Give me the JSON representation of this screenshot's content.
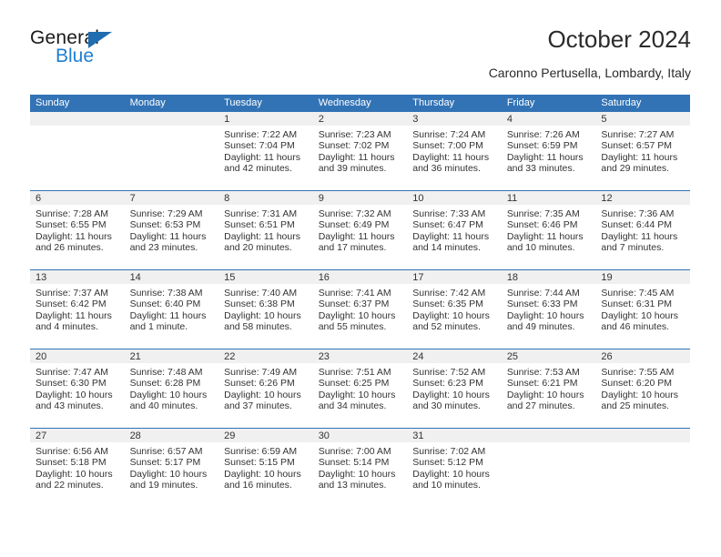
{
  "logo": {
    "word_top": "General",
    "word_bottom": "Blue",
    "triangle_color": "#1f6cb0",
    "blue_color": "#1f7fd1"
  },
  "header": {
    "title": "October 2024",
    "subtitle": "Caronno Pertusella, Lombardy, Italy"
  },
  "theme": {
    "header_blue": "#3273b5",
    "band_gray": "#f0f0f0",
    "text": "#333333"
  },
  "calendar": {
    "weekday_headers": [
      "Sunday",
      "Monday",
      "Tuesday",
      "Wednesday",
      "Thursday",
      "Friday",
      "Saturday"
    ],
    "weeks": [
      [
        {
          "day": "",
          "sunrise": "",
          "sunset": "",
          "daylight": ""
        },
        {
          "day": "",
          "sunrise": "",
          "sunset": "",
          "daylight": ""
        },
        {
          "day": "1",
          "sunrise": "Sunrise: 7:22 AM",
          "sunset": "Sunset: 7:04 PM",
          "daylight": "Daylight: 11 hours and 42 minutes."
        },
        {
          "day": "2",
          "sunrise": "Sunrise: 7:23 AM",
          "sunset": "Sunset: 7:02 PM",
          "daylight": "Daylight: 11 hours and 39 minutes."
        },
        {
          "day": "3",
          "sunrise": "Sunrise: 7:24 AM",
          "sunset": "Sunset: 7:00 PM",
          "daylight": "Daylight: 11 hours and 36 minutes."
        },
        {
          "day": "4",
          "sunrise": "Sunrise: 7:26 AM",
          "sunset": "Sunset: 6:59 PM",
          "daylight": "Daylight: 11 hours and 33 minutes."
        },
        {
          "day": "5",
          "sunrise": "Sunrise: 7:27 AM",
          "sunset": "Sunset: 6:57 PM",
          "daylight": "Daylight: 11 hours and 29 minutes."
        }
      ],
      [
        {
          "day": "6",
          "sunrise": "Sunrise: 7:28 AM",
          "sunset": "Sunset: 6:55 PM",
          "daylight": "Daylight: 11 hours and 26 minutes."
        },
        {
          "day": "7",
          "sunrise": "Sunrise: 7:29 AM",
          "sunset": "Sunset: 6:53 PM",
          "daylight": "Daylight: 11 hours and 23 minutes."
        },
        {
          "day": "8",
          "sunrise": "Sunrise: 7:31 AM",
          "sunset": "Sunset: 6:51 PM",
          "daylight": "Daylight: 11 hours and 20 minutes."
        },
        {
          "day": "9",
          "sunrise": "Sunrise: 7:32 AM",
          "sunset": "Sunset: 6:49 PM",
          "daylight": "Daylight: 11 hours and 17 minutes."
        },
        {
          "day": "10",
          "sunrise": "Sunrise: 7:33 AM",
          "sunset": "Sunset: 6:47 PM",
          "daylight": "Daylight: 11 hours and 14 minutes."
        },
        {
          "day": "11",
          "sunrise": "Sunrise: 7:35 AM",
          "sunset": "Sunset: 6:46 PM",
          "daylight": "Daylight: 11 hours and 10 minutes."
        },
        {
          "day": "12",
          "sunrise": "Sunrise: 7:36 AM",
          "sunset": "Sunset: 6:44 PM",
          "daylight": "Daylight: 11 hours and 7 minutes."
        }
      ],
      [
        {
          "day": "13",
          "sunrise": "Sunrise: 7:37 AM",
          "sunset": "Sunset: 6:42 PM",
          "daylight": "Daylight: 11 hours and 4 minutes."
        },
        {
          "day": "14",
          "sunrise": "Sunrise: 7:38 AM",
          "sunset": "Sunset: 6:40 PM",
          "daylight": "Daylight: 11 hours and 1 minute."
        },
        {
          "day": "15",
          "sunrise": "Sunrise: 7:40 AM",
          "sunset": "Sunset: 6:38 PM",
          "daylight": "Daylight: 10 hours and 58 minutes."
        },
        {
          "day": "16",
          "sunrise": "Sunrise: 7:41 AM",
          "sunset": "Sunset: 6:37 PM",
          "daylight": "Daylight: 10 hours and 55 minutes."
        },
        {
          "day": "17",
          "sunrise": "Sunrise: 7:42 AM",
          "sunset": "Sunset: 6:35 PM",
          "daylight": "Daylight: 10 hours and 52 minutes."
        },
        {
          "day": "18",
          "sunrise": "Sunrise: 7:44 AM",
          "sunset": "Sunset: 6:33 PM",
          "daylight": "Daylight: 10 hours and 49 minutes."
        },
        {
          "day": "19",
          "sunrise": "Sunrise: 7:45 AM",
          "sunset": "Sunset: 6:31 PM",
          "daylight": "Daylight: 10 hours and 46 minutes."
        }
      ],
      [
        {
          "day": "20",
          "sunrise": "Sunrise: 7:47 AM",
          "sunset": "Sunset: 6:30 PM",
          "daylight": "Daylight: 10 hours and 43 minutes."
        },
        {
          "day": "21",
          "sunrise": "Sunrise: 7:48 AM",
          "sunset": "Sunset: 6:28 PM",
          "daylight": "Daylight: 10 hours and 40 minutes."
        },
        {
          "day": "22",
          "sunrise": "Sunrise: 7:49 AM",
          "sunset": "Sunset: 6:26 PM",
          "daylight": "Daylight: 10 hours and 37 minutes."
        },
        {
          "day": "23",
          "sunrise": "Sunrise: 7:51 AM",
          "sunset": "Sunset: 6:25 PM",
          "daylight": "Daylight: 10 hours and 34 minutes."
        },
        {
          "day": "24",
          "sunrise": "Sunrise: 7:52 AM",
          "sunset": "Sunset: 6:23 PM",
          "daylight": "Daylight: 10 hours and 30 minutes."
        },
        {
          "day": "25",
          "sunrise": "Sunrise: 7:53 AM",
          "sunset": "Sunset: 6:21 PM",
          "daylight": "Daylight: 10 hours and 27 minutes."
        },
        {
          "day": "26",
          "sunrise": "Sunrise: 7:55 AM",
          "sunset": "Sunset: 6:20 PM",
          "daylight": "Daylight: 10 hours and 25 minutes."
        }
      ],
      [
        {
          "day": "27",
          "sunrise": "Sunrise: 6:56 AM",
          "sunset": "Sunset: 5:18 PM",
          "daylight": "Daylight: 10 hours and 22 minutes."
        },
        {
          "day": "28",
          "sunrise": "Sunrise: 6:57 AM",
          "sunset": "Sunset: 5:17 PM",
          "daylight": "Daylight: 10 hours and 19 minutes."
        },
        {
          "day": "29",
          "sunrise": "Sunrise: 6:59 AM",
          "sunset": "Sunset: 5:15 PM",
          "daylight": "Daylight: 10 hours and 16 minutes."
        },
        {
          "day": "30",
          "sunrise": "Sunrise: 7:00 AM",
          "sunset": "Sunset: 5:14 PM",
          "daylight": "Daylight: 10 hours and 13 minutes."
        },
        {
          "day": "31",
          "sunrise": "Sunrise: 7:02 AM",
          "sunset": "Sunset: 5:12 PM",
          "daylight": "Daylight: 10 hours and 10 minutes."
        },
        {
          "day": "",
          "sunrise": "",
          "sunset": "",
          "daylight": ""
        },
        {
          "day": "",
          "sunrise": "",
          "sunset": "",
          "daylight": ""
        }
      ]
    ]
  }
}
